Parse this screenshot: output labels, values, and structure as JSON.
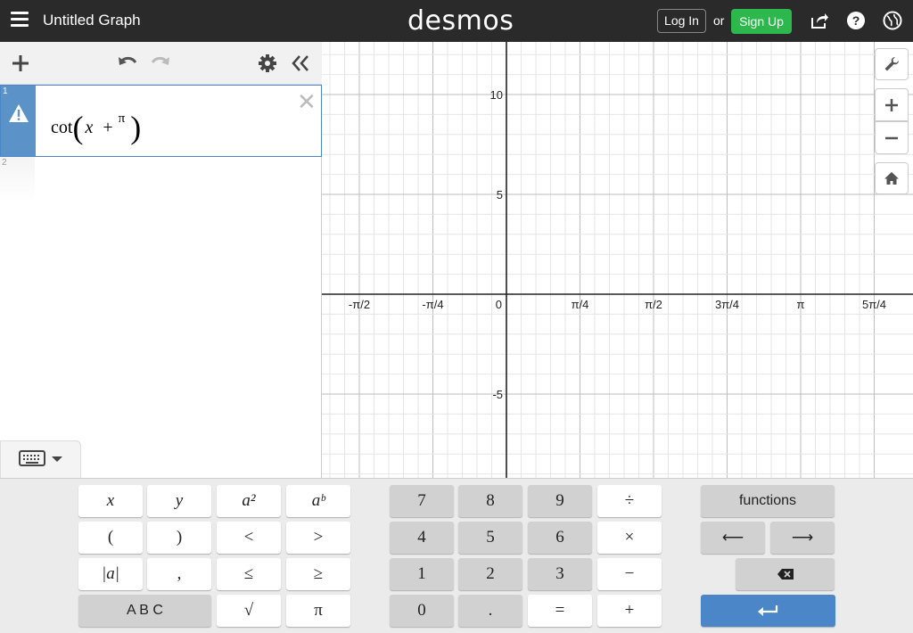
{
  "header": {
    "graph_title": "Untitled Graph",
    "logo": "desmos",
    "login_label": "Log In",
    "or_text": "or",
    "signup_label": "Sign Up",
    "signup_color": "#2db84e",
    "icons": [
      "share-icon",
      "help-icon",
      "globe-icon"
    ]
  },
  "expressions": [
    {
      "number": "1",
      "latex_display": "cot(x + π)",
      "parts": {
        "fn": "cot",
        "var": "x",
        "op": "+",
        "frac_top": "π"
      },
      "status": "warning"
    },
    {
      "number": "2",
      "latex_display": ""
    }
  ],
  "graph": {
    "x_tick_labels": [
      "-π/2",
      "-π/4",
      "0",
      "π/4",
      "π/2",
      "3π/4",
      "π",
      "5π/4"
    ],
    "y_tick_labels": [
      "10",
      "5",
      "-5"
    ]
  },
  "keypad": {
    "left": [
      [
        "x",
        "y",
        "a²",
        "aᵇ"
      ],
      [
        "(",
        ")",
        "<",
        ">"
      ],
      [
        "|a|",
        ",",
        "≤",
        "≥"
      ],
      [
        "A B C",
        "√",
        "π"
      ]
    ],
    "middle": [
      [
        "7",
        "8",
        "9",
        "÷"
      ],
      [
        "4",
        "5",
        "6",
        "×"
      ],
      [
        "1",
        "2",
        "3",
        "−"
      ],
      [
        "0",
        ".",
        "=",
        "+"
      ]
    ],
    "right": {
      "functions_label": "functions",
      "left_arrow": "⟵",
      "right_arrow": "⟶",
      "backspace": "⌫",
      "enter": "↵"
    }
  },
  "colors": {
    "header_bg": "#2a2a2a",
    "expr_gutter": "#5b93c9",
    "enter_key": "#4b86c8"
  }
}
